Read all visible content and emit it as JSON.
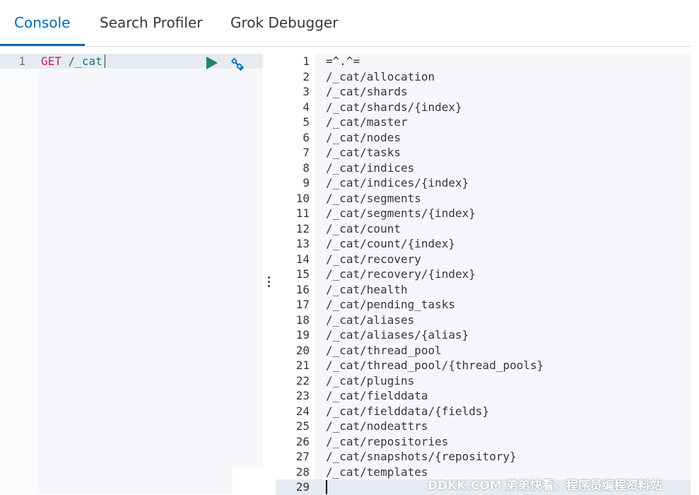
{
  "tabs": [
    {
      "label": "Console",
      "active": true
    },
    {
      "label": "Search Profiler",
      "active": false
    },
    {
      "label": "Grok Debugger",
      "active": false
    }
  ],
  "request": {
    "line_number": "1",
    "method": "GET",
    "path": "/_cat",
    "run_icon": "play-icon",
    "tools_icon": "wrench-icon"
  },
  "output": {
    "current_line": 29,
    "lines": [
      "=^.^=",
      "/_cat/allocation",
      "/_cat/shards",
      "/_cat/shards/{index}",
      "/_cat/master",
      "/_cat/nodes",
      "/_cat/tasks",
      "/_cat/indices",
      "/_cat/indices/{index}",
      "/_cat/segments",
      "/_cat/segments/{index}",
      "/_cat/count",
      "/_cat/count/{index}",
      "/_cat/recovery",
      "/_cat/recovery/{index}",
      "/_cat/health",
      "/_cat/pending_tasks",
      "/_cat/aliases",
      "/_cat/aliases/{alias}",
      "/_cat/thread_pool",
      "/_cat/thread_pool/{thread_pools}",
      "/_cat/plugins",
      "/_cat/fielddata",
      "/_cat/fielddata/{fields}",
      "/_cat/nodeattrs",
      "/_cat/repositories",
      "/_cat/snapshots/{repository}",
      "/_cat/templates",
      ""
    ]
  },
  "watermark": "DDKK.COM 弟弟快看，程序员编程资料站",
  "colors": {
    "accent": "#006bb8",
    "method": "#c61e6b",
    "path": "#2a6c8a",
    "run": "#1a8a5e"
  }
}
